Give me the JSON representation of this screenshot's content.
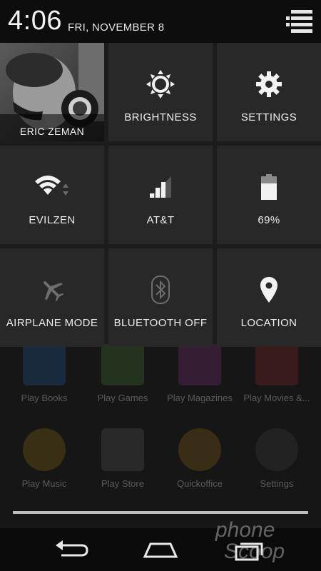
{
  "status": {
    "time": "4:06",
    "date": "FRI, NOVEMBER 8"
  },
  "user": {
    "name": "ERIC ZEMAN"
  },
  "tiles": {
    "brightness": "BRIGHTNESS",
    "settings": "SETTINGS",
    "wifi": "EVILZEN",
    "carrier": "AT&T",
    "battery": "69%",
    "airplane": "AIRPLANE MODE",
    "bluetooth": "BLUETOOTH OFF",
    "location": "LOCATION"
  },
  "battery_level": 0.69,
  "signal_bars_filled": 3,
  "home_apps": [
    "Play Books",
    "Play Games",
    "Play Magazines",
    "Play Movies &...",
    "Play Music",
    "Play Store",
    "Quickoffice",
    "Settings"
  ],
  "watermark": "Phone Scoop"
}
